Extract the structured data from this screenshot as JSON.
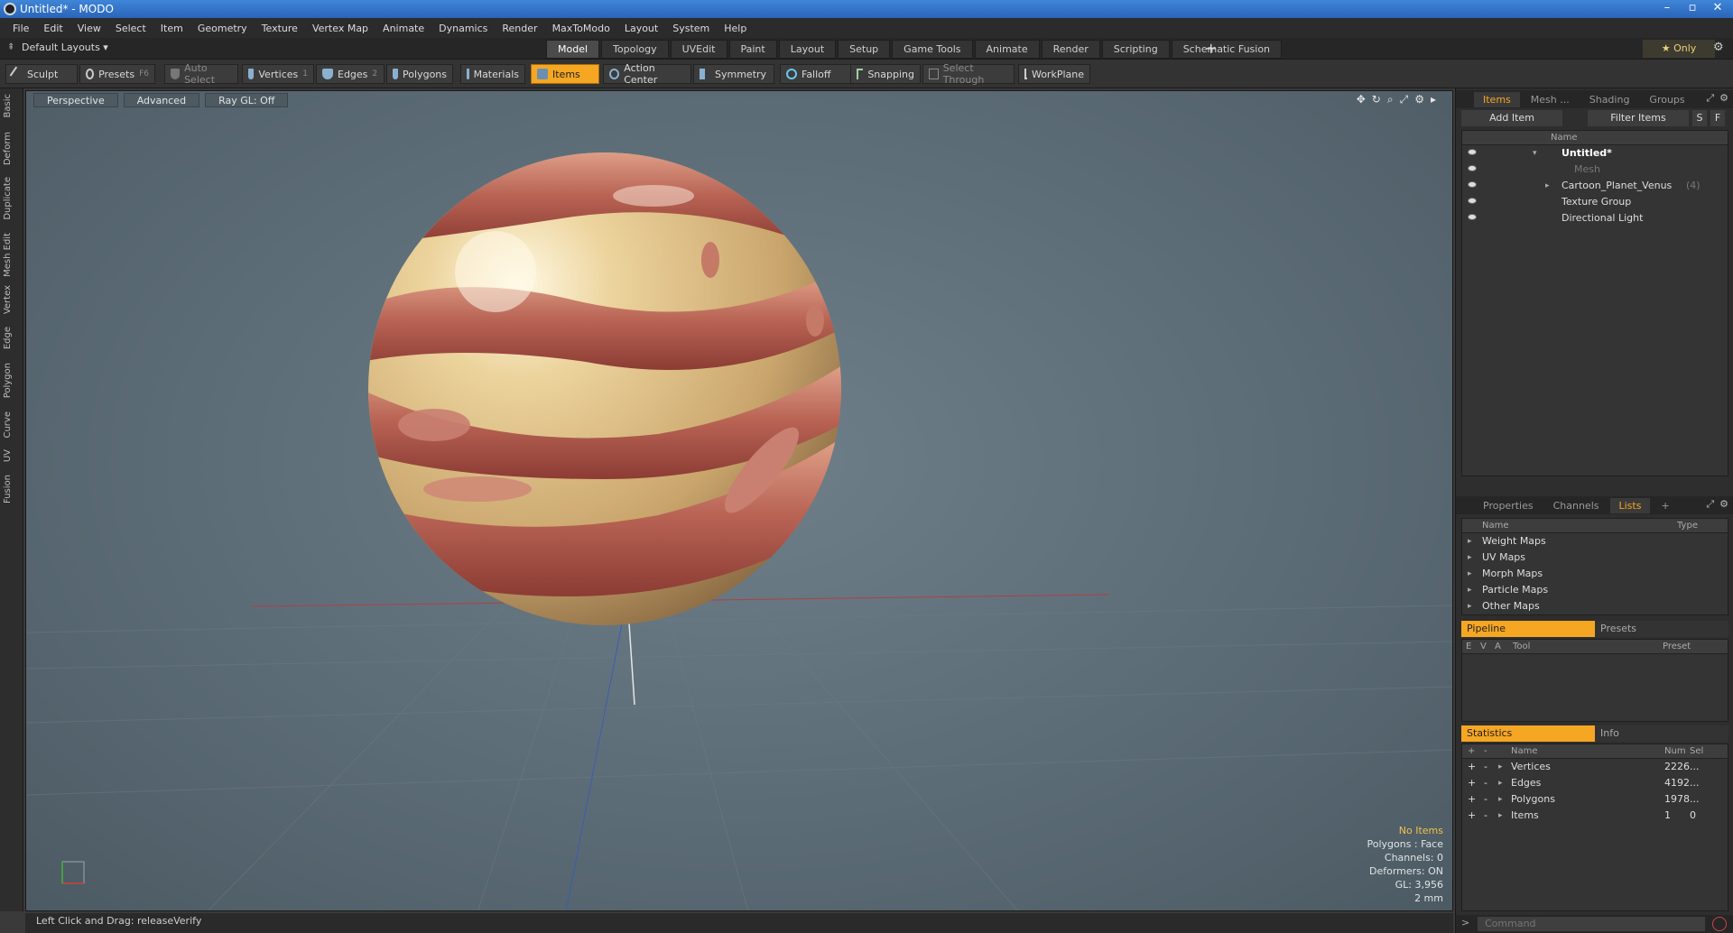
{
  "window": {
    "title": "Untitled* - MODO",
    "minimize": "–",
    "maximize": "▫",
    "close": "✕"
  },
  "menubar": [
    "File",
    "Edit",
    "View",
    "Select",
    "Item",
    "Geometry",
    "Texture",
    "Vertex Map",
    "Animate",
    "Dynamics",
    "Render",
    "MaxToModo",
    "Layout",
    "System",
    "Help"
  ],
  "layoutbar": {
    "layouts_label": "Default Layouts ▾",
    "tabs": [
      "Model",
      "Topology",
      "UVEdit",
      "Paint",
      "Layout",
      "Setup",
      "Game Tools",
      "Animate",
      "Render",
      "Scripting",
      "Schematic Fusion"
    ],
    "active_tab": "Model",
    "plus": "+",
    "only_label": "★ Only",
    "gear": "⚙"
  },
  "toolbar": {
    "sculpt": "Sculpt",
    "presets": "Presets",
    "presets_key": "F6",
    "auto_select": "Auto Select",
    "vertices": "Vertices",
    "vertices_key": "1",
    "edges": "Edges",
    "edges_key": "2",
    "polygons": "Polygons",
    "materials": "Materials",
    "items": "Items",
    "action_center": "Action Center",
    "symmetry": "Symmetry",
    "falloff": "Falloff",
    "snapping": "Snapping",
    "select_through": "Select Through",
    "workplane": "WorkPlane"
  },
  "lefttabs": [
    "Basic",
    "Deform",
    "Duplicate",
    "Mesh Edit",
    "Vertex",
    "Edge",
    "Polygon",
    "Curve",
    "UV",
    "Fusion"
  ],
  "viewport": {
    "perspective": "Perspective",
    "advanced": "Advanced",
    "raygl": "Ray GL: Off",
    "stats": {
      "no_items": "No Items",
      "polygons": "Polygons : Face",
      "channels": "Channels: 0",
      "deformers": "Deformers: ON",
      "gl": "GL: 3,956",
      "scale": "2 mm"
    }
  },
  "statusbar": {
    "text": "Left Click and Drag:   releaseVerify"
  },
  "items_panel": {
    "tabs": [
      "Items",
      "Mesh ...",
      "Shading",
      "Groups"
    ],
    "active_tab": "Items",
    "add_item": "Add Item",
    "filter_items": "Filter Items",
    "s_btn": "S",
    "f_btn": "F",
    "name_col": "Name",
    "rows": [
      {
        "label": "Untitled*",
        "indent": 0
      },
      {
        "label": "Mesh",
        "indent": 2
      },
      {
        "label": "Cartoon_Planet_Venus",
        "indent": 1,
        "count": "(4)"
      },
      {
        "label": "Texture Group",
        "indent": 1
      },
      {
        "label": "Directional Light",
        "indent": 1
      }
    ]
  },
  "props_panel": {
    "tabs": [
      "Properties",
      "Channels",
      "Lists"
    ],
    "active_tab": "Lists",
    "plus": "+",
    "name_col": "Name",
    "type_col": "Type",
    "rows": [
      "Weight Maps",
      "UV Maps",
      "Morph Maps",
      "Particle Maps",
      "Other Maps"
    ]
  },
  "pipeline_panel": {
    "tab1": "Pipeline",
    "tab2": "Presets",
    "cols": {
      "e": "E",
      "v": "V",
      "a": "A",
      "tool": "Tool",
      "preset": "Preset"
    }
  },
  "stats_panel": {
    "tab1": "Statistics",
    "tab2": "Info",
    "cols": {
      "plus": "+",
      "minus": "-",
      "name": "Name",
      "num": "Num",
      "sel": "Sel"
    },
    "rows": [
      {
        "name": "Vertices",
        "num": "2226",
        "sel": "..."
      },
      {
        "name": "Edges",
        "num": "4192",
        "sel": "..."
      },
      {
        "name": "Polygons",
        "num": "1978",
        "sel": "..."
      },
      {
        "name": "Items",
        "num": "1",
        "sel": "0"
      }
    ]
  },
  "command": {
    "placeholder": "Command"
  },
  "colors": {
    "accent": "#f5a623",
    "viewport": "#5f6f79",
    "planet_tan": "#e4c48a",
    "planet_red": "#b65a4c"
  }
}
